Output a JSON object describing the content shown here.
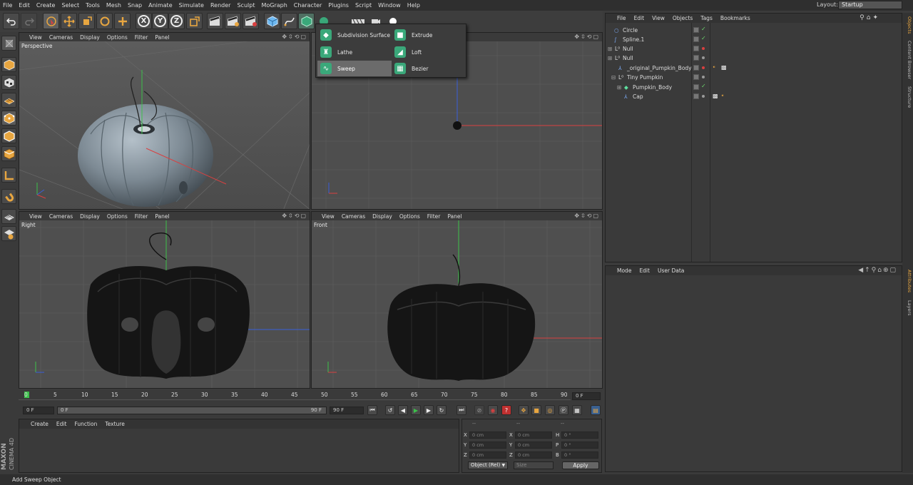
{
  "menubar": {
    "items": [
      "File",
      "Edit",
      "Create",
      "Select",
      "Tools",
      "Mesh",
      "Snap",
      "Animate",
      "Simulate",
      "Render",
      "Sculpt",
      "MoGraph",
      "Character",
      "Plugins",
      "Script",
      "Window",
      "Help"
    ],
    "layout_label": "Layout:",
    "layout_value": "Startup"
  },
  "toolbar": {
    "icons": [
      "undo-icon",
      "redo-icon",
      "live-selection-icon",
      "move-icon",
      "scale-icon",
      "rotate-icon",
      "add-icon",
      "x-axis-lock",
      "y-axis-lock",
      "z-axis-lock",
      "world-coordinates-icon",
      "render-view-icon",
      "render-picture-viewer-icon",
      "edit-render-settings-icon",
      "cube-primitive-icon",
      "spline-pen-icon",
      "nurbs-generator-icon",
      "deformer-icon",
      "scene-icon",
      "camera-icon",
      "light-icon"
    ],
    "axis_labels": [
      "X",
      "Y",
      "Z"
    ]
  },
  "generator_popup": {
    "items": [
      {
        "label": "Subdivision Surface",
        "icon": "subdivision-surface-icon"
      },
      {
        "label": "Extrude",
        "icon": "extrude-icon"
      },
      {
        "label": "Lathe",
        "icon": "lathe-icon"
      },
      {
        "label": "Loft",
        "icon": "loft-icon"
      },
      {
        "label": "Sweep",
        "icon": "sweep-icon"
      },
      {
        "label": "Bezier",
        "icon": "bezier-icon"
      }
    ],
    "selected": "Sweep"
  },
  "viewports": {
    "menu": [
      "View",
      "Cameras",
      "Display",
      "Options",
      "Filter",
      "Panel"
    ],
    "perspective": "Perspective",
    "right": "Right",
    "front": "Front",
    "top": ""
  },
  "object_manager": {
    "menu": [
      "File",
      "Edit",
      "View",
      "Objects",
      "Tags",
      "Bookmarks"
    ],
    "objects": [
      {
        "name": "Circle",
        "check": "✓"
      },
      {
        "name": "Spline.1",
        "check": "✓"
      },
      {
        "name": "Null",
        "check": ""
      },
      {
        "name": "Null",
        "check": ""
      },
      {
        "name": "_original_Pumpkin_Body",
        "check": ""
      },
      {
        "name": "Tiny Pumpkin",
        "check": ""
      },
      {
        "name": "Pumpkin_Body",
        "check": "✓"
      },
      {
        "name": "Cap",
        "check": ""
      }
    ]
  },
  "attribute_manager": {
    "menu": [
      "Mode",
      "Edit",
      "User Data"
    ]
  },
  "right_tabs": [
    "Objects",
    "Content Browser",
    "Structure",
    "Attributes",
    "Layers"
  ],
  "timeline": {
    "ticks": [
      "0",
      "5",
      "10",
      "15",
      "20",
      "25",
      "30",
      "35",
      "40",
      "45",
      "50",
      "55",
      "60",
      "65",
      "70",
      "75",
      "80",
      "85",
      "90"
    ],
    "current_frame": "0 F",
    "start_field": "0 F",
    "slider_start": "0 F",
    "slider_end": "90 F",
    "end_field": "90 F"
  },
  "material_manager": {
    "menu": [
      "Create",
      "Edit",
      "Function",
      "Texture"
    ]
  },
  "coordinates": {
    "header": [
      "--",
      "--",
      "--"
    ],
    "rows": [
      {
        "a": "X",
        "av": "0 cm",
        "b": "X",
        "bv": "0 cm",
        "c": "H",
        "cv": "0 °"
      },
      {
        "a": "Y",
        "av": "0 cm",
        "b": "Y",
        "bv": "0 cm",
        "c": "P",
        "cv": "0 °"
      },
      {
        "a": "Z",
        "av": "0 cm",
        "b": "Z",
        "bv": "0 cm",
        "c": "B",
        "cv": "0 °"
      }
    ],
    "mode_select": "Object (Rel)",
    "size_select": "Size",
    "apply_label": "Apply"
  },
  "brand": {
    "line1": "MAXON",
    "line2": "CINEMA 4D"
  },
  "status": "Add Sweep Object",
  "colors": {
    "accent": "#e8a640",
    "generator_green": "#3aa87a",
    "axis_x": "#d94040",
    "axis_y": "#3cc04a",
    "axis_z": "#3a5fd9"
  }
}
